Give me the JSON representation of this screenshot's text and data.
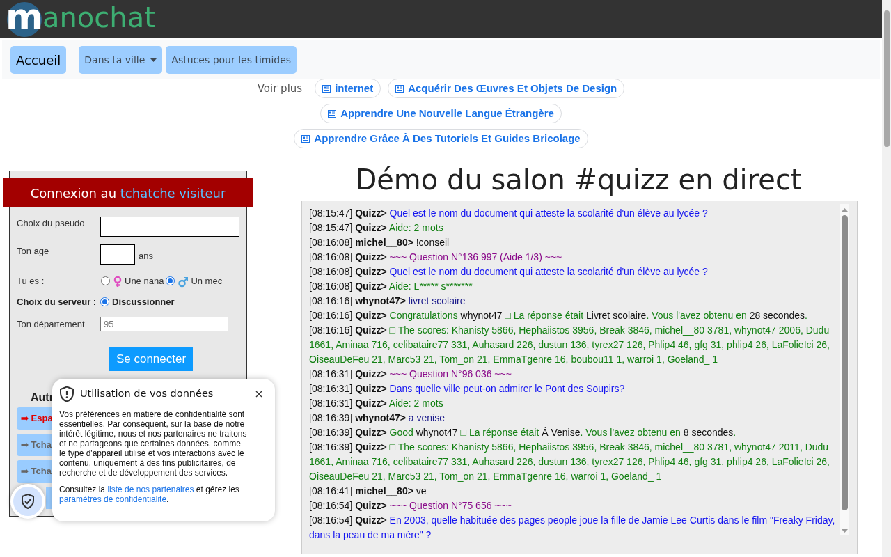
{
  "logo": {
    "initial": "m",
    "rest": "anochat"
  },
  "nav": [
    {
      "label": "Accueil",
      "selected": true,
      "dropdown": false
    },
    {
      "label": "Dans ta ville",
      "selected": false,
      "dropdown": true
    },
    {
      "label": "Astuces pour les timides",
      "selected": false,
      "dropdown": false
    }
  ],
  "see_more": {
    "label": "Voir plus",
    "chips": [
      "internet",
      "Acquérir Des Œuvres Et Objets De Design",
      "Apprendre Une Nouvelle Langue Étrangère",
      "Apprendre Grâce À Des Tutoriels Et Guides Bricolage"
    ]
  },
  "login": {
    "title": "Connexion au ",
    "title_link": "tchatche visiteur",
    "pseudo_label": "Choix du pseudo",
    "age_label": "Ton age",
    "age_unit": "ans",
    "gender_label": "Tu es :",
    "genders": [
      {
        "label": "Une nana",
        "kind": "female",
        "selected": false
      },
      {
        "label": "Un mec",
        "kind": "male",
        "selected": true
      }
    ],
    "server_label": "Choix du serveur :",
    "servers": [
      {
        "label": "Discussionner",
        "selected": true
      }
    ],
    "department_label": "Ton département",
    "department_placeholder": "95",
    "submit": "Se connecter",
    "others_heading": "Autr",
    "other_links": [
      {
        "label": "➡ Espa",
        "kind": "highlight"
      },
      {
        "label": "➡ Tcha",
        "kind": "normal"
      },
      {
        "label": "➡ Tcha",
        "kind": "normal"
      }
    ]
  },
  "demo": {
    "title": "Démo du salon #quizz en direct",
    "messages": [
      {
        "time": "[08:15:47]",
        "nick": "Quizz>",
        "parts": [
          {
            "kind": "question",
            "text": "Quel est le nom du document qui atteste la scolarité d'un élève au lycée ?"
          }
        ]
      },
      {
        "time": "[08:15:47]",
        "nick": "Quizz>",
        "parts": [
          {
            "kind": "info",
            "text": "Aide: 2 mots"
          }
        ]
      },
      {
        "time": "[08:16:08]",
        "nick": "michel__80>",
        "parts": [
          {
            "kind": "plain",
            "text": "!conseil"
          }
        ]
      },
      {
        "time": "[08:16:08]",
        "nick": "Quizz>",
        "parts": [
          {
            "kind": "header",
            "text": "~~~ Question N°136 997 (Aide 1/3) ~~~"
          }
        ]
      },
      {
        "time": "[08:16:08]",
        "nick": "Quizz>",
        "parts": [
          {
            "kind": "question",
            "text": "Quel est le nom du document qui atteste la scolarité d'un élève au lycée ?"
          }
        ]
      },
      {
        "time": "[08:16:08]",
        "nick": "Quizz>",
        "parts": [
          {
            "kind": "info",
            "text": "Aide: L***** s*******"
          }
        ]
      },
      {
        "time": "[08:16:16]",
        "nick": "whynot47>",
        "parts": [
          {
            "kind": "answer",
            "text": "livret scolaire"
          }
        ]
      },
      {
        "time": "[08:16:16]",
        "nick": "Quizz>",
        "parts": [
          {
            "kind": "info",
            "text": "Congratulations "
          },
          {
            "kind": "plain",
            "text": "whynot47 "
          },
          {
            "kind": "info",
            "text": "□ La réponse était "
          },
          {
            "kind": "plain",
            "text": "Livret scolaire"
          },
          {
            "kind": "info",
            "text": ". Vous l'avez obtenu en "
          },
          {
            "kind": "plain",
            "text": "28 secondes"
          },
          {
            "kind": "info",
            "text": "."
          }
        ]
      },
      {
        "time": "[08:16:16]",
        "nick": "Quizz>",
        "parts": [
          {
            "kind": "info",
            "text": "□ The scores: Khanisty 5866, Hephaiistos 3956, Break 3846, michel__80 3781, whynot47 2006, Dudu 1661, Aminaa 716, celibataire77 331, Auhasard 226, dustun 136, tyrex27 126, Phlip4 46, gfg 31, phlip4 26, LaFolieIci 26, OiseauDeFeu 21, Marc53 21, Tom_on 21, EmmaTgenre 16, boubou11 1, warroi 1, Goeland_ 1"
          }
        ]
      },
      {
        "time": "[08:16:31]",
        "nick": "Quizz>",
        "parts": [
          {
            "kind": "header",
            "text": "~~~ Question N°96 036 ~~~"
          }
        ]
      },
      {
        "time": "[08:16:31]",
        "nick": "Quizz>",
        "parts": [
          {
            "kind": "question",
            "text": "Dans quelle ville peut-on admirer le Pont des Soupirs?"
          }
        ]
      },
      {
        "time": "[08:16:31]",
        "nick": "Quizz>",
        "parts": [
          {
            "kind": "info",
            "text": "Aide: 2 mots"
          }
        ]
      },
      {
        "time": "[08:16:39]",
        "nick": "whynot47>",
        "parts": [
          {
            "kind": "answer",
            "text": "a venise"
          }
        ]
      },
      {
        "time": "[08:16:39]",
        "nick": "Quizz>",
        "parts": [
          {
            "kind": "info",
            "text": "Good "
          },
          {
            "kind": "plain",
            "text": "whynot47 "
          },
          {
            "kind": "info",
            "text": "□ La réponse était "
          },
          {
            "kind": "plain",
            "text": "À Venise"
          },
          {
            "kind": "info",
            "text": ". Vous l'avez obtenu en "
          },
          {
            "kind": "plain",
            "text": "8 secondes"
          },
          {
            "kind": "info",
            "text": "."
          }
        ]
      },
      {
        "time": "[08:16:39]",
        "nick": "Quizz>",
        "parts": [
          {
            "kind": "info",
            "text": "□ The scores: Khanisty 5866, Hephaiistos 3956, Break 3846, michel__80 3781, whynot47 2011, Dudu 1661, Aminaa 716, celibataire77 331, Auhasard 226, dustun 136, tyrex27 126, Phlip4 46, gfg 31, phlip4 26, LaFolieIci 26, OiseauDeFeu 21, Marc53 21, Tom_on 21, EmmaTgenre 16, warroi 1, Goeland_ 1"
          }
        ]
      },
      {
        "time": "[08:16:41]",
        "nick": "michel__80>",
        "parts": [
          {
            "kind": "plain",
            "text": "ve"
          }
        ]
      },
      {
        "time": "[08:16:54]",
        "nick": "Quizz>",
        "parts": [
          {
            "kind": "header",
            "text": "~~~ Question N°75 656 ~~~"
          }
        ]
      },
      {
        "time": "[08:16:54]",
        "nick": "Quizz>",
        "parts": [
          {
            "kind": "question",
            "text": "En 2003, quelle habituée des pages people joue la fille de Jamie Lee Curtis dans le film \"Freaky Friday, dans la peau de ma mère\" ?"
          }
        ]
      }
    ]
  },
  "consent": {
    "title": "Utilisation de vos données",
    "body": "Vos préférences en matière de confidentialité sont essentielles. Par conséquent, sur la base de notre intérêt légitime, nous et nos partenaires ne traitons et ne partageons que certaines données, comme le type d'appareil utilisé et vos interactions avec le contenu, uniquement à des fins publicitaires, de recherche et de développement des services.",
    "footer_before": "Consultez la ",
    "footer_link1": "liste de nos partenaires",
    "footer_middle": " et gérez les ",
    "footer_link2": "paramètres de confidentialité",
    "footer_after": "."
  }
}
